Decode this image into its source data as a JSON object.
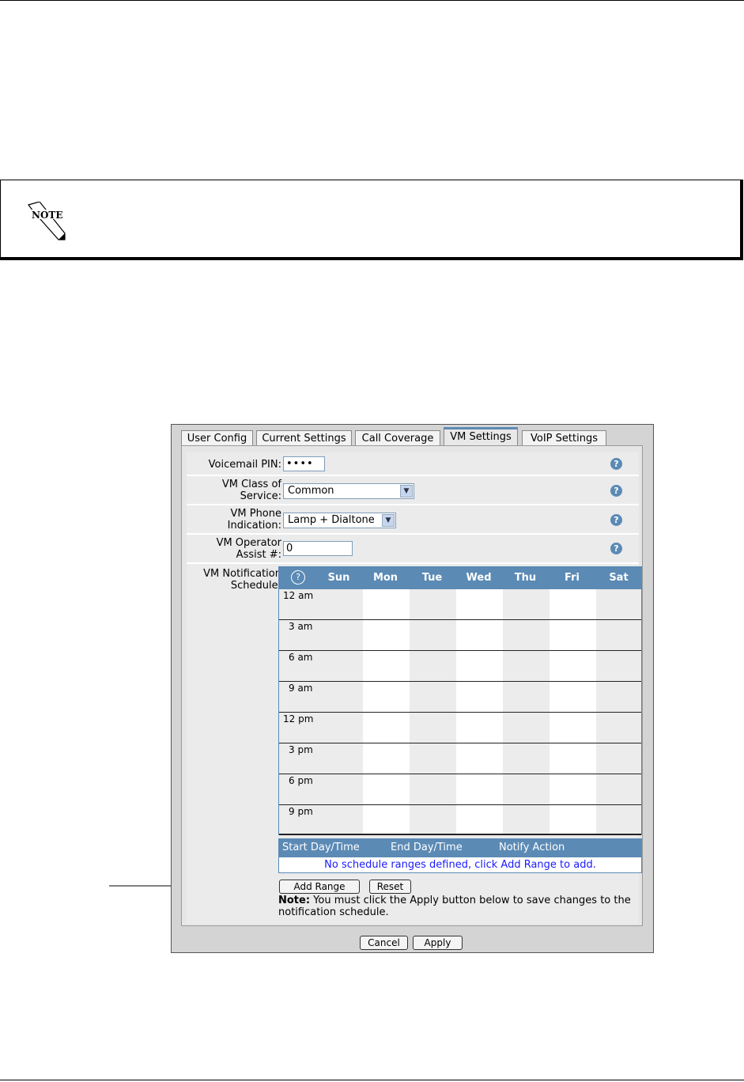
{
  "note": {
    "icon": "note-pencil-icon",
    "label": "NOTE"
  },
  "tabs": [
    "User Config",
    "Current Settings",
    "Call Coverage",
    "VM Settings",
    "VoIP Settings"
  ],
  "active_tab": "VM Settings",
  "form": {
    "voicemail_pin_label": "Voicemail PIN:",
    "voicemail_pin_value": "••••",
    "class_label_1": "VM Class of",
    "class_label_2": "Service:",
    "class_value": "Common",
    "indication_label_1": "VM Phone",
    "indication_label_2": "Indication:",
    "indication_value": "Lamp + Dialtone",
    "operator_label_1": "VM Operator",
    "operator_label_2": "Assist #:",
    "operator_value": "0",
    "schedule_label_1": "VM Notification",
    "schedule_label_2": "Schedule:",
    "help_glyph": "?"
  },
  "schedule": {
    "days": [
      "Sun",
      "Mon",
      "Tue",
      "Wed",
      "Thu",
      "Fri",
      "Sat"
    ],
    "times": [
      "12 am",
      "3 am",
      "6 am",
      "9 am",
      "12 pm",
      "3 pm",
      "6 pm",
      "9 pm"
    ],
    "range_headers": {
      "start": "Start Day/Time",
      "end": "End Day/Time",
      "action": "Notify Action"
    },
    "empty_message": "No schedule ranges defined, click Add Range to add."
  },
  "buttons": {
    "add_range": "Add Range",
    "reset": "Reset",
    "cancel": "Cancel",
    "apply": "Apply"
  },
  "footnote": {
    "bold": "Note:",
    "text": " You must click the Apply button below to save changes to the notification schedule."
  },
  "colors": {
    "accent": "#5b8ab5",
    "link": "#1a1aff"
  }
}
